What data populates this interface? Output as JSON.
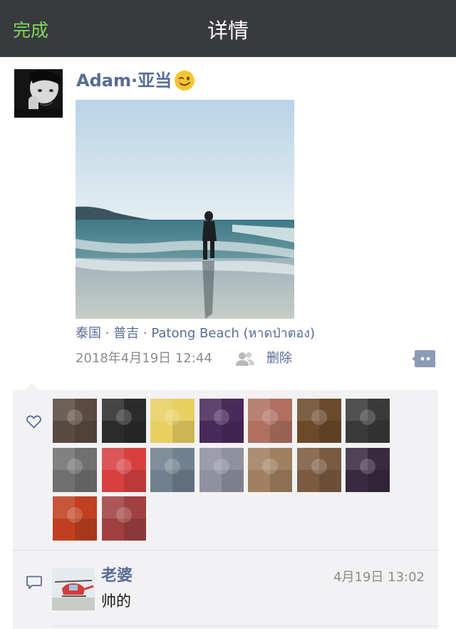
{
  "navbar": {
    "done_label": "完成",
    "title": "详情"
  },
  "post": {
    "author": "Adam·亚当",
    "location": "泰国 · 普吉 · Patong Beach (หาดป่าตอง)",
    "time": "2018年4月19日 12:44",
    "delete_label": "删除",
    "icons": {
      "emoji": "wink-emoji",
      "visibility": "friends-icon",
      "comment_toggle": "comment-more-icon"
    }
  },
  "likes": {
    "icon": "heart-icon",
    "likers": [
      {
        "avatar": "liker-avatar",
        "color": "#5a4a40"
      },
      {
        "avatar": "liker-avatar",
        "color": "#2c2c2c"
      },
      {
        "avatar": "liker-avatar",
        "color": "#e8d060"
      },
      {
        "avatar": "liker-avatar",
        "color": "#4a2a5a"
      },
      {
        "avatar": "liker-avatar",
        "color": "#b07060"
      },
      {
        "avatar": "liker-avatar",
        "color": "#6a4a2a"
      },
      {
        "avatar": "liker-avatar",
        "color": "#3a3a3a"
      },
      {
        "avatar": "liker-avatar",
        "color": "#707070"
      },
      {
        "avatar": "liker-avatar",
        "color": "#d84040"
      },
      {
        "avatar": "liker-avatar",
        "color": "#708090"
      },
      {
        "avatar": "liker-avatar",
        "color": "#9090a0"
      },
      {
        "avatar": "liker-avatar",
        "color": "#a08060"
      },
      {
        "avatar": "liker-avatar",
        "color": "#7a5a40"
      },
      {
        "avatar": "liker-avatar",
        "color": "#3a2a40"
      },
      {
        "avatar": "liker-avatar",
        "color": "#c04020"
      },
      {
        "avatar": "liker-avatar",
        "color": "#a04040"
      }
    ]
  },
  "comments": [
    {
      "name": "老婆",
      "time": "4月19日 13:02",
      "text": "帅的"
    }
  ],
  "colors": {
    "navbar_bg": "#393a3e",
    "accent_green": "#7dd75a",
    "link_blue": "#576b95",
    "panel_bg": "#f2f2f4"
  }
}
